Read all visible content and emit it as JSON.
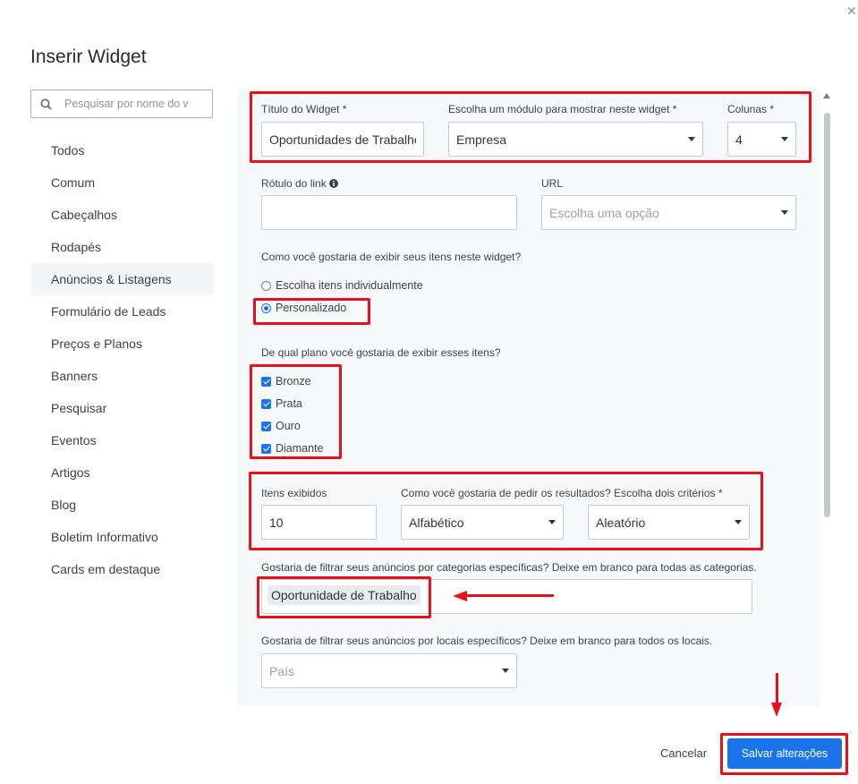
{
  "modal": {
    "title": "Inserir Widget",
    "close_icon": "close-icon"
  },
  "sidebar": {
    "search_placeholder": "Pesquisar por nome do w",
    "items": [
      {
        "label": "Todos"
      },
      {
        "label": "Comum"
      },
      {
        "label": "Cabeçalhos"
      },
      {
        "label": "Rodapés"
      },
      {
        "label": "Anúncios & Listagens",
        "active": true
      },
      {
        "label": "Formulário de Leads"
      },
      {
        "label": "Preços e Planos"
      },
      {
        "label": "Banners"
      },
      {
        "label": "Pesquisar"
      },
      {
        "label": "Eventos"
      },
      {
        "label": "Artigos"
      },
      {
        "label": "Blog"
      },
      {
        "label": "Boletim Informativo"
      },
      {
        "label": "Cards em destaque"
      }
    ]
  },
  "form": {
    "widget_title_label": "Título do Widget *",
    "widget_title_value": "Oportunidades de Trabalho",
    "module_label": "Escolha um módulo para mostrar neste widget *",
    "module_value": "Empresa",
    "columns_label": "Colunas *",
    "columns_value": "4",
    "link_label": "Rótulo do link",
    "link_value": "",
    "url_label": "URL",
    "url_placeholder": "Escolha uma opção",
    "display_question": "Como você gostaria de exibir seus itens neste widget?",
    "display_options": [
      {
        "label": "Escolha itens individualmente",
        "selected": false
      },
      {
        "label": "Personalizado",
        "selected": true
      }
    ],
    "plan_question": "De qual plano você gostaria de exibir esses itens?",
    "plans": [
      {
        "label": "Bronze",
        "checked": true
      },
      {
        "label": "Prata",
        "checked": true
      },
      {
        "label": "Ouro",
        "checked": true
      },
      {
        "label": "Diamante",
        "checked": true
      }
    ],
    "items_label": "Itens exibidos",
    "items_value": "10",
    "order_label": "Como você gostaria de pedir os resultados? Escolha dois critérios *",
    "order_first": "Alfabético",
    "order_second": "Aleatório",
    "categories_question": "Gostaria de filtrar seus anúncios por categorias específicas? Deixe em branco para todas as categorias.",
    "category_tag": "Oportunidade de Trabalho",
    "locations_question": "Gostaria de filtrar seus anúncios por locais específicos? Deixe em branco para todos os locais.",
    "country_placeholder": "País"
  },
  "footer": {
    "cancel_label": "Cancelar",
    "save_label": "Salvar alterações"
  },
  "colors": {
    "accent": "#1a73e8",
    "annotation": "#e8101a"
  }
}
